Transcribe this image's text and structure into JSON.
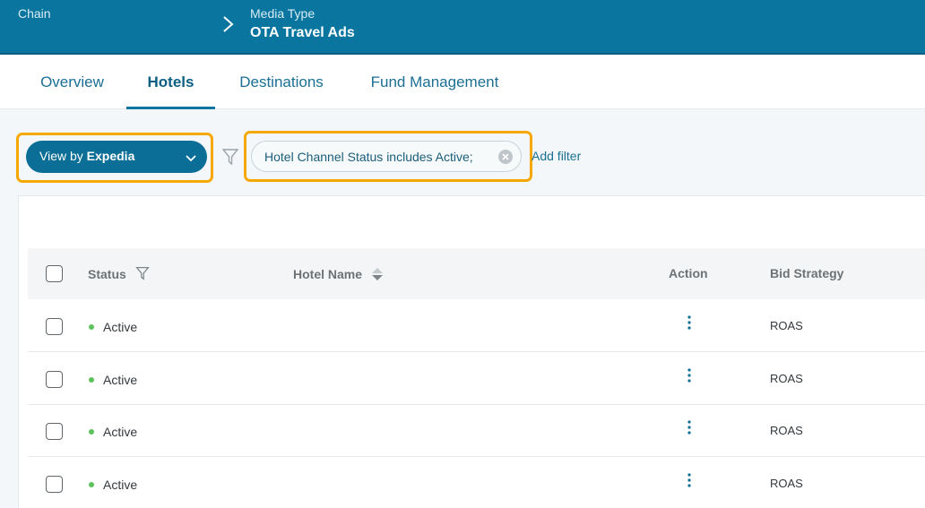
{
  "header": {
    "chain_label": "Chain",
    "media_type_label": "Media Type",
    "media_type_value": "OTA Travel Ads"
  },
  "tabs": [
    {
      "label": "Overview",
      "active": false
    },
    {
      "label": "Hotels",
      "active": true
    },
    {
      "label": "Destinations",
      "active": false
    },
    {
      "label": "Fund Management",
      "active": false
    }
  ],
  "toolbar": {
    "view_prefix": "View by",
    "view_value": "Expedia",
    "filter_chip": "Hotel Channel Status includes Active;",
    "add_filter": "Add filter"
  },
  "table": {
    "columns": {
      "status": "Status",
      "hotel_name": "Hotel Name",
      "action": "Action",
      "bid_strategy": "Bid Strategy"
    },
    "rows": [
      {
        "status": "Active",
        "bid_strategy": "ROAS"
      },
      {
        "status": "Active",
        "bid_strategy": "ROAS"
      },
      {
        "status": "Active",
        "bid_strategy": "ROAS"
      },
      {
        "status": "Active",
        "bid_strategy": "ROAS"
      }
    ]
  },
  "colors": {
    "header_bg": "#0a76a0",
    "highlight": "#f6a800",
    "status_active": "#5cc25a"
  },
  "icons": [
    "chevron-right-icon",
    "chevron-down-icon",
    "filter-icon",
    "clear-icon",
    "sort-icon",
    "kebab-menu-icon"
  ]
}
